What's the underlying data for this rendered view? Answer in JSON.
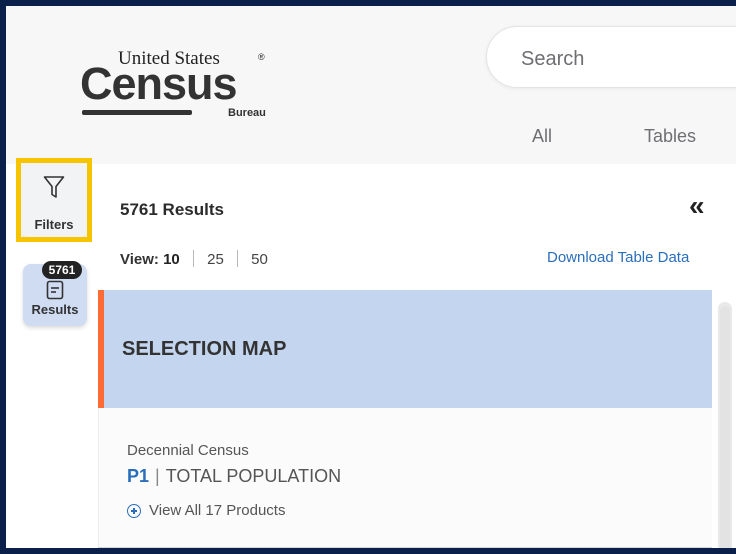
{
  "header": {
    "logo": {
      "line1": "United States",
      "reg_mark": "®",
      "main": "Census",
      "sub": "Bureau"
    },
    "search": {
      "placeholder": "Search",
      "value": ""
    },
    "tabs": [
      {
        "label": "All"
      },
      {
        "label": "Tables"
      }
    ]
  },
  "rail": {
    "filters": {
      "label": "Filters",
      "icon": "filter-icon",
      "highlight_color": "#f7c400"
    },
    "results": {
      "label": "Results",
      "badge": "5761",
      "icon": "document-list-icon",
      "bg_color": "#cfdcf2"
    }
  },
  "results_panel": {
    "count_text": "5761 Results",
    "collapse_glyph": "«",
    "view": {
      "label": "View:",
      "options": [
        "10",
        "25",
        "50"
      ],
      "selected": "10"
    },
    "download_label": "Download Table Data",
    "selection_map": {
      "title": "SELECTION MAP",
      "accent_color": "#ff6b35",
      "bg_color": "#c4d6ef"
    },
    "items": [
      {
        "program": "Decennial Census",
        "table_id": "P1",
        "separator": "|",
        "title": "TOTAL POPULATION",
        "products_link": "View All 17 Products"
      }
    ]
  },
  "colors": {
    "frame": "#0b1f4b",
    "link": "#2a6ebb"
  }
}
